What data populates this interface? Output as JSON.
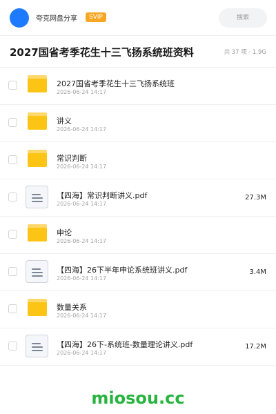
{
  "header": {
    "brand": "夸克网盘分享",
    "badge": "SVIP",
    "search_placeholder": "搜索"
  },
  "folder": {
    "title": "2027国省考季花生十三飞扬系统班资料",
    "summary": "共 37 项 · 1.9G"
  },
  "items": [
    {
      "type": "folder",
      "name": "2027国省考季花生十三飞扬系统班",
      "date": "2026-06-24 14:17",
      "size": ""
    },
    {
      "type": "folder",
      "name": "讲义",
      "date": "2026-06-24 14:17",
      "size": ""
    },
    {
      "type": "folder",
      "name": "常识判断",
      "date": "2026-06-24 14:17",
      "size": ""
    },
    {
      "type": "file",
      "name": "【四海】常识判断讲义.pdf",
      "date": "2026-06-24 14:17",
      "size": "27.3M"
    },
    {
      "type": "folder",
      "name": "申论",
      "date": "2026-06-24 14:17",
      "size": ""
    },
    {
      "type": "file",
      "name": "【四海】26下半年申论系统班讲义.pdf",
      "date": "2026-06-24 14:17",
      "size": "3.4M"
    },
    {
      "type": "folder",
      "name": "数量关系",
      "date": "2026-06-24 14:17",
      "size": ""
    },
    {
      "type": "file",
      "name": "【四海】26下-系统班-数量理论讲义.pdf",
      "date": "2026-06-24 14:17",
      "size": "17.2M"
    }
  ],
  "watermark": "miosou.cc",
  "colors": {
    "avatar": "#1e7bff",
    "badge": "#f7a623",
    "folder": "#fcc516",
    "watermark": "#26b33e"
  }
}
